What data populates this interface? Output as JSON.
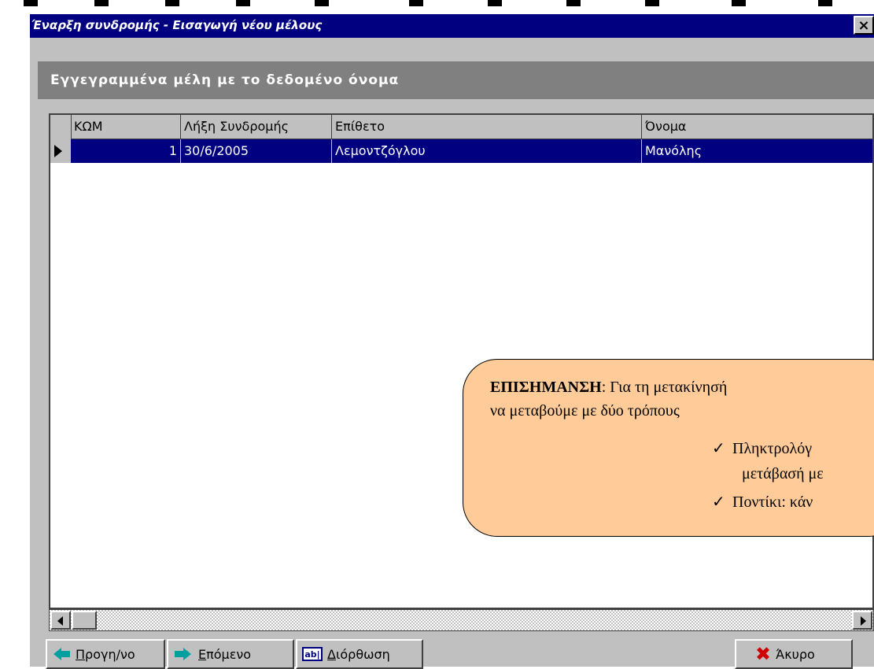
{
  "window": {
    "title": "Έναρξη συνδρομής - Εισαγωγή νέου μέλους",
    "close_label": "×"
  },
  "group": {
    "title": "Εγγεγραμμένα μέλη με το δεδομένο όνομα"
  },
  "grid": {
    "columns": [
      "ΚΩΜ",
      "Λήξη Συνδρομής",
      "Επίθετο",
      "Όνομα"
    ],
    "rows": [
      {
        "kom": "1",
        "expiry": "30/6/2005",
        "surname": "Λεμοντζόγλου",
        "name": "Μανόλης"
      }
    ]
  },
  "buttons": {
    "prev_hotkey": "Π",
    "prev_rest": "ρογη/νο",
    "next_hotkey": "Ε",
    "next_rest": "πόμενο",
    "edit_icon_text": "ab|",
    "edit_hotkey": "Δ",
    "edit_rest": "ιόρθωση",
    "cancel": "Άκυρο"
  },
  "callout": {
    "bold": "ΕΠΙΣΗΜΑΝΣΗ",
    "line1": ": Για τη μετακίνησή",
    "line2": "να μεταβούμε με δύο τρόπους",
    "item1": "Πληκτρολόγ",
    "item1_cont": "μετάβασή με",
    "item2": "Ποντίκι: κάν"
  },
  "colors": {
    "titlebar": "#000080",
    "selection": "#000080",
    "callout_bg": "#ffcc99",
    "cancel_icon": "#d00000",
    "arrow_icon": "#00a0a0"
  }
}
